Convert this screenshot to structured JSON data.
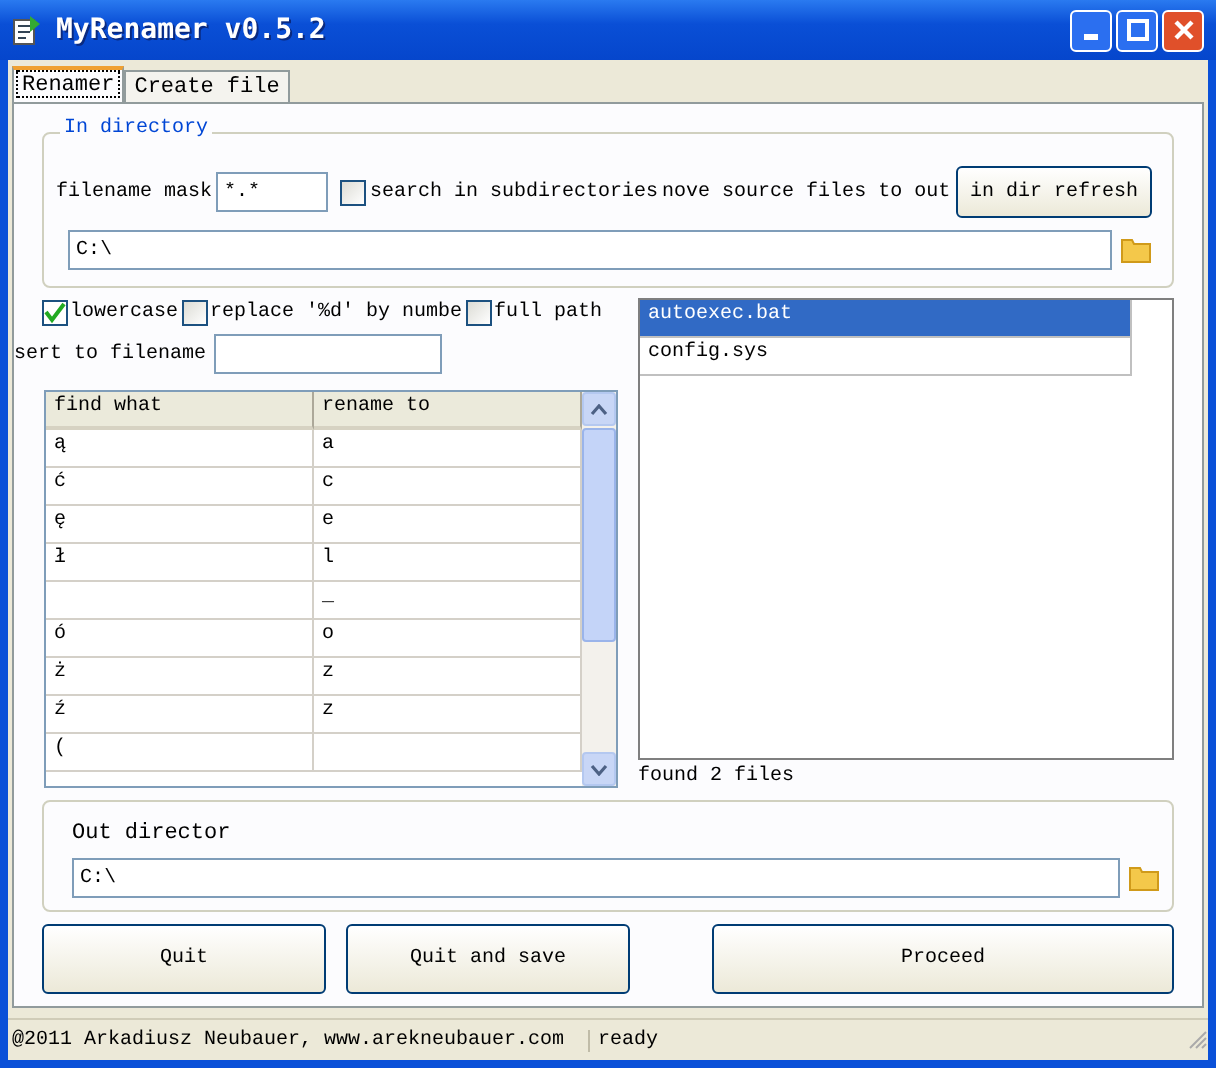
{
  "window": {
    "title": "MyRenamer v0.5.2"
  },
  "tabs": [
    {
      "label": "Renamer",
      "selected": true
    },
    {
      "label": "Create file",
      "selected": false
    }
  ],
  "in_directory": {
    "title": "In directory",
    "mask_label": "filename mask",
    "mask": "*.*",
    "search_subdirs": {
      "label": "search in subdirectories",
      "checked": false
    },
    "move_label": "nove source files to out",
    "refresh_button": "in dir refresh",
    "path": "C:\\"
  },
  "options": [
    {
      "label": "lowercase",
      "checked": true
    },
    {
      "label": "replace '%d' by numbe",
      "checked": false
    },
    {
      "label": "full path",
      "checked": false
    }
  ],
  "insert_label": "sert to filename",
  "table": {
    "columns": [
      "find what",
      "rename to"
    ],
    "rows": [
      {
        "find": "ą",
        "rename": "a"
      },
      {
        "find": "ć",
        "rename": "c"
      },
      {
        "find": "ę",
        "rename": "e"
      },
      {
        "find": "ł",
        "rename": "l"
      },
      {
        "rename": "_"
      },
      {
        "find": "ó",
        "rename": "o"
      },
      {
        "find": "ż",
        "rename": "z"
      },
      {
        "find": "ź",
        "rename": "z"
      },
      {
        "find": "("
      }
    ]
  },
  "files": [
    {
      "name": "autoexec.bat",
      "selected": true
    },
    {
      "name": "config.sys",
      "selected": false
    }
  ],
  "found": "found 2 files",
  "out_directory": {
    "title": "Out director",
    "path": "C:\\"
  },
  "buttons": [
    "Quit",
    "Quit and save",
    "Proceed"
  ],
  "status_bar": [
    "@2011 Arkadiusz Neubauer, www.arekneubauer.com",
    "ready"
  ]
}
